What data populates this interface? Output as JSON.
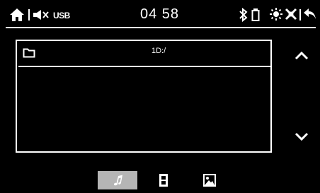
{
  "status_bar": {
    "source_label": "USB",
    "clock": "04 58",
    "icons": [
      "home-icon",
      "mute-icon",
      "bluetooth-icon",
      "battery-icon",
      "brightness-icon",
      "display-off-icon",
      "back-icon"
    ]
  },
  "file_browser": {
    "path": "1D:/",
    "folder_icon": "folder-icon"
  },
  "scroll": {
    "up_icon": "chevron-up-icon",
    "down_icon": "chevron-down-icon"
  },
  "tabs": [
    {
      "icon": "music-note-icon",
      "active": true
    },
    {
      "icon": "video-icon",
      "active": false
    },
    {
      "icon": "image-icon",
      "active": false
    }
  ],
  "colors": {
    "background": "#000000",
    "foreground": "#ffffff",
    "active_tab": "#b5b5b5"
  }
}
